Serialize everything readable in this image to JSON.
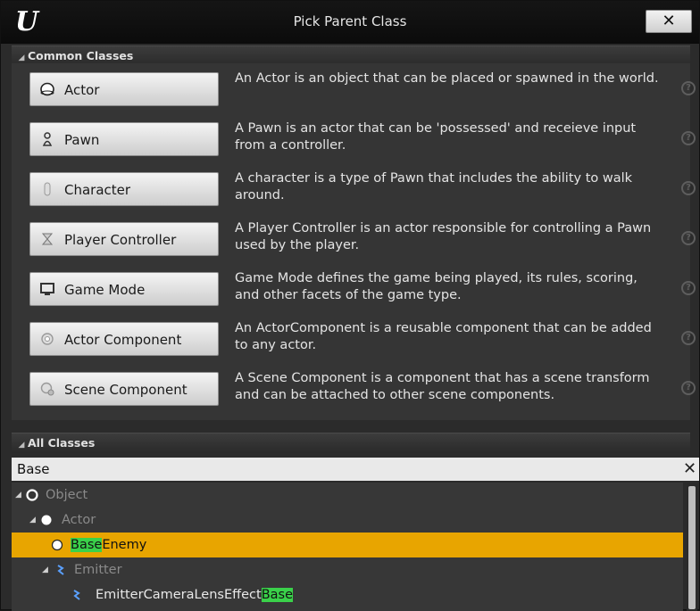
{
  "window": {
    "title": "Pick Parent Class",
    "close_label": "✕"
  },
  "common_classes": {
    "header": "Common Classes",
    "items": [
      {
        "label": "Actor",
        "description": "An Actor is an object that can be placed or spawned in the world.",
        "icon": "sphere-icon"
      },
      {
        "label": "Pawn",
        "description": "A Pawn is an actor that can be 'possessed' and receieve input from a controller.",
        "icon": "pawn-icon"
      },
      {
        "label": "Character",
        "description": "A character is a type of Pawn that includes the ability to walk around.",
        "icon": "character-icon"
      },
      {
        "label": "Player Controller",
        "description": "A Player Controller is an actor responsible for controlling a Pawn used by the player.",
        "icon": "player-controller-icon"
      },
      {
        "label": "Game Mode",
        "description": "Game Mode defines the game being played, its rules, scoring, and other facets of the game type.",
        "icon": "monitor-icon"
      },
      {
        "label": "Actor Component",
        "description": "An ActorComponent is a reusable component that can be added to any actor.",
        "icon": "component-icon"
      },
      {
        "label": "Scene Component",
        "description": "A Scene Component is a component that has a scene transform and can be attached to other scene components.",
        "icon": "scene-component-icon"
      }
    ]
  },
  "all_classes": {
    "header": "All Classes",
    "search": {
      "value": "Base",
      "clear_label": "✕"
    },
    "tree": [
      {
        "label_pre": "",
        "label_hl": "",
        "label_post": "Object",
        "selected": false
      },
      {
        "label_pre": "",
        "label_hl": "",
        "label_post": "Actor",
        "selected": false
      },
      {
        "label_pre": "",
        "label_hl": "Base",
        "label_post": "Enemy",
        "selected": true
      },
      {
        "label_pre": "",
        "label_hl": "",
        "label_post": "Emitter",
        "selected": false
      },
      {
        "label_pre": "EmitterCameraLensEffect",
        "label_hl": "Base",
        "label_post": "",
        "selected": false
      }
    ]
  },
  "colors": {
    "selection": "#e8a500",
    "match_highlight": "#3ad14a"
  }
}
